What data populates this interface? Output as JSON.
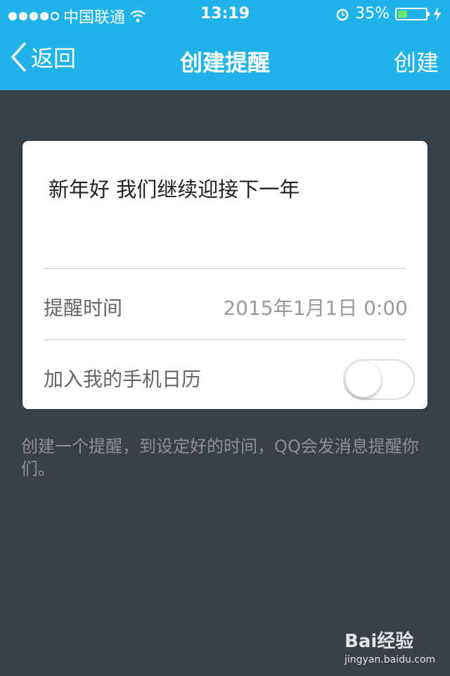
{
  "status_bar": {
    "carrier": "中国联通",
    "time": "13:19",
    "battery": "35%",
    "battery_level": 0.35
  },
  "nav": {
    "back_label": "返回",
    "title": "创建提醒",
    "action_label": "创建"
  },
  "reminder": {
    "content": "新年好 我们继续迎接下一年",
    "time_label": "提醒时间",
    "time_value": "2015年1月1日 0:00",
    "calendar_label": "加入我的手机日历",
    "calendar_enabled": false
  },
  "hint": "创建一个提醒，到设定好的时间，QQ会发消息提醒你们。",
  "watermark": {
    "brand": "Bai经验",
    "url": "jingyan.baidu.com"
  },
  "colors": {
    "header": "#1fb3ea",
    "background": "#3a4048",
    "battery_fill": "#6ee36e"
  }
}
